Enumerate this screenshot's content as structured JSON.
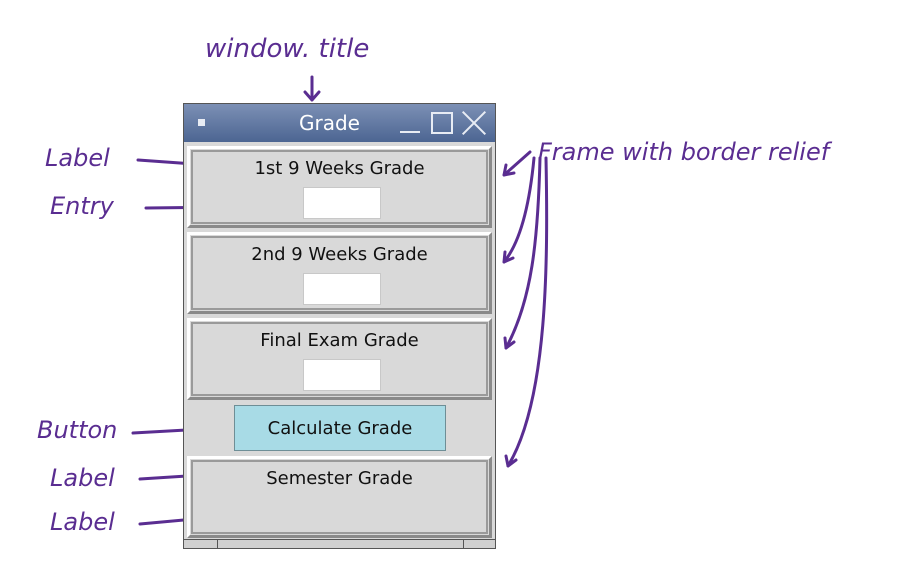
{
  "window": {
    "title": "Grade",
    "frames": [
      {
        "label": "1st 9 Weeks Grade",
        "entry_value": ""
      },
      {
        "label": "2nd 9 Weeks Grade",
        "entry_value": ""
      },
      {
        "label": "Final Exam Grade",
        "entry_value": ""
      }
    ],
    "calculate_button": "Calculate Grade",
    "result_frame": {
      "label": "Semester Grade",
      "value": ""
    }
  },
  "annotations": {
    "window_title": "window. title",
    "label": "Label",
    "entry": "Entry",
    "button": "Button",
    "frame": "Frame with border relief",
    "label2": "Label",
    "label3": "Label"
  },
  "colors": {
    "annotation": "#5a2d91",
    "titlebar": "#5b7299",
    "button": "#a8dbe6",
    "window_bg": "#d9d9d9"
  }
}
